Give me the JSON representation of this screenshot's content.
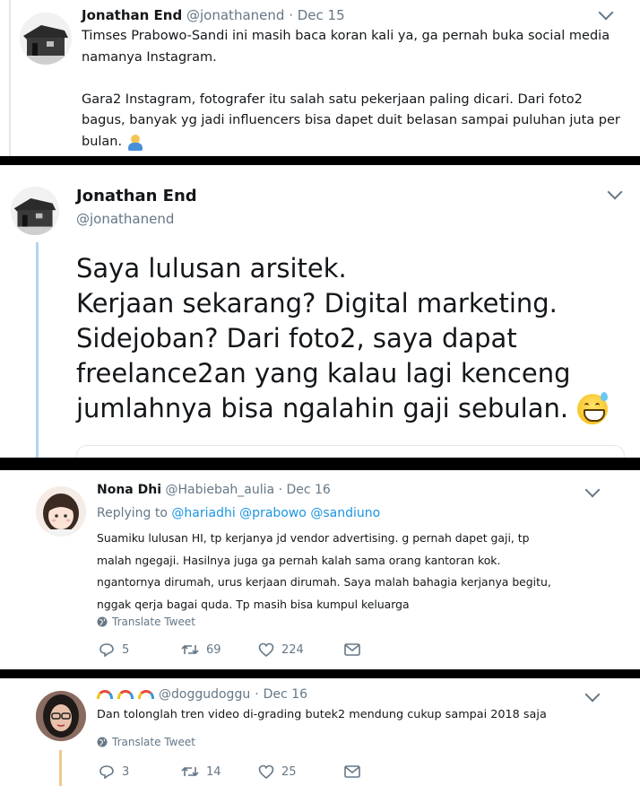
{
  "tweet1": {
    "name": "Jonathan End",
    "handle": "@jonathanend",
    "dot": "·",
    "date": "Dec 15",
    "lines": [
      "Timses Prabowo-Sandi ini masih baca koran kali ya, ga pernah buka social media",
      "namanya Instagram.",
      "",
      "Gara2 Instagram, fotografer itu salah satu pekerjaan paling dicari. Dari foto2",
      "bagus, banyak yg jadi influencers bisa dapet duit belasan sampai puluhan juta per",
      "bulan."
    ],
    "emoji": "shrug-person-emoji"
  },
  "tweet2": {
    "name": "Jonathan End",
    "handle": "@jonathanend",
    "lines": [
      "Saya lulusan arsitek.",
      "Kerjaan sekarang? Digital marketing.",
      "Sidejoban? Dari foto2, saya dapat",
      "freelance2an yang kalau lagi kenceng",
      "jumlahnya bisa ngalahin gaji sebulan."
    ],
    "emoji": "grinning-sweat-emoji"
  },
  "tweet3": {
    "name": "Nona Dhi",
    "handle": "@Habiebah_aulia",
    "dot": "·",
    "date": "Dec 16",
    "replying_label": "Replying to",
    "mentions": [
      "@hariadhi",
      "@prabowo",
      "@sandiuno"
    ],
    "lines": [
      "Suamiku lulusan HI, tp kerjanya jd vendor advertising. g pernah dapet gaji, tp",
      "malah ngegaji. Hasilnya juga ga pernah kalah sama orang kantoran kok.",
      "ngantornya dirumah, urus kerjaan dirumah. Saya malah bahagia kerjanya begitu,",
      "nggak qerja bagai quda. Tp masih bisa kumpul keluarga"
    ],
    "translate": "Translate Tweet",
    "replies": "5",
    "retweets": "69",
    "likes": "224"
  },
  "tweet4": {
    "name_icons": "rainbow-emoji rainbow-emoji rainbow-emoji",
    "handle": "@doggudoggu",
    "dot": "·",
    "date": "Dec 16",
    "text": "Dan tolonglah tren video di-grading butek2 mendung cukup sampai 2018 saja",
    "translate": "Translate Tweet",
    "replies": "3",
    "retweets": "14",
    "likes": "25"
  },
  "colors": {
    "link": "#1b95e0",
    "muted": "#657786",
    "thread_line": "#aed6f1",
    "thread_line_bottom": "#f0c98a",
    "separator": "#000000"
  }
}
